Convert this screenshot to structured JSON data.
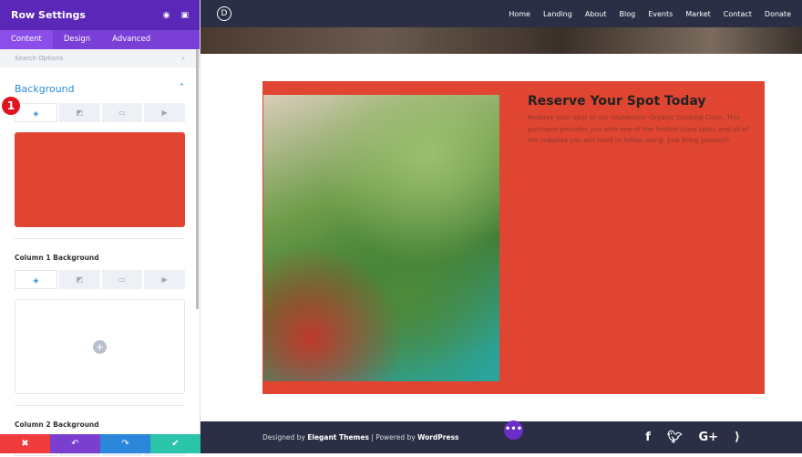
{
  "panel": {
    "title": "Row Settings",
    "tabs": [
      "Content",
      "Design",
      "Advanced"
    ],
    "search_placeholder": "Search Options",
    "section": "Background",
    "badge": "1",
    "col1": "Column 1 Background",
    "col2": "Column 2 Background",
    "bg_color": "#e04531"
  },
  "nav": {
    "logo": "D",
    "items": [
      "Home",
      "Landing",
      "About",
      "Blog",
      "Events",
      "Market",
      "Contact",
      "Donate"
    ]
  },
  "content": {
    "heading": "Reserve Your Spot Today",
    "body": "Reserve your spot at our September Organic Cooking Class. This purchase provides you with one of the limited class spots and all of the supplies you will need to follow along. Just bring yourself!"
  },
  "footer": {
    "designed": "Designed by ",
    "et": "Elegant Themes",
    "powered": " | Powered by ",
    "wp": "WordPress"
  }
}
